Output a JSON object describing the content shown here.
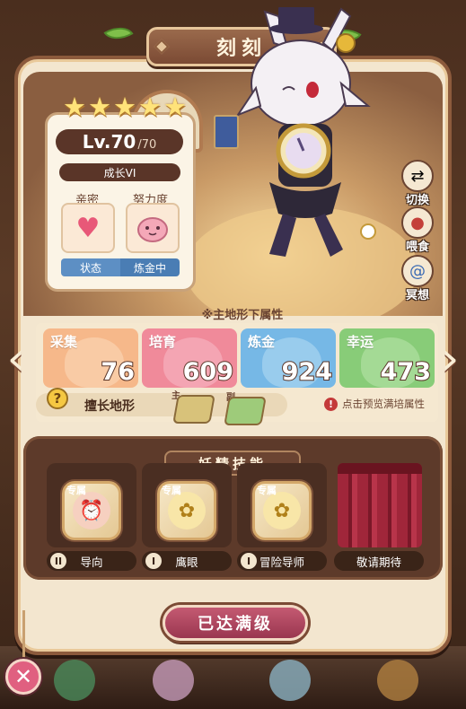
{
  "header": {
    "title": "刻刻"
  },
  "character": {
    "stars": 5,
    "level_label": "Lv.70",
    "level_max": "/70",
    "growth_label": "成长VI",
    "intimacy_label": "亲密",
    "effort_label": "努力度",
    "status_label": "状态",
    "status_value": "炼金中"
  },
  "actions": {
    "switch_label": "切换",
    "feed_label": "喂食",
    "meditate_label": "冥想"
  },
  "attributes": {
    "title": "※主地形下属性",
    "items": [
      {
        "name": "采集",
        "value": "76",
        "color": "#f2a06a"
      },
      {
        "name": "培育",
        "value": "609",
        "color": "#ee6a7e"
      },
      {
        "name": "炼金",
        "value": "924",
        "color": "#5aa8e0"
      },
      {
        "name": "幸运",
        "value": "473",
        "color": "#6ec05a"
      }
    ],
    "terrain_label": "擅长地形",
    "terrain_main_tag": "主",
    "terrain_sub_tag": "副",
    "preview_hint": "点击预览满培属性"
  },
  "skills": {
    "title": "妖精技能",
    "exclusive_tag": "专属",
    "items": [
      {
        "name": "导向",
        "rank": "II",
        "icon": "alarm-clock-icon"
      },
      {
        "name": "鹰眼",
        "rank": "I",
        "icon": "bee-icon"
      },
      {
        "name": "冒险导师",
        "rank": "I",
        "icon": "bee-icon"
      },
      {
        "name": "敬请期待",
        "rank": "",
        "icon": "curtain-icon"
      }
    ]
  },
  "footer": {
    "max_button_label": "已达满级",
    "close_icon": "close-icon"
  }
}
